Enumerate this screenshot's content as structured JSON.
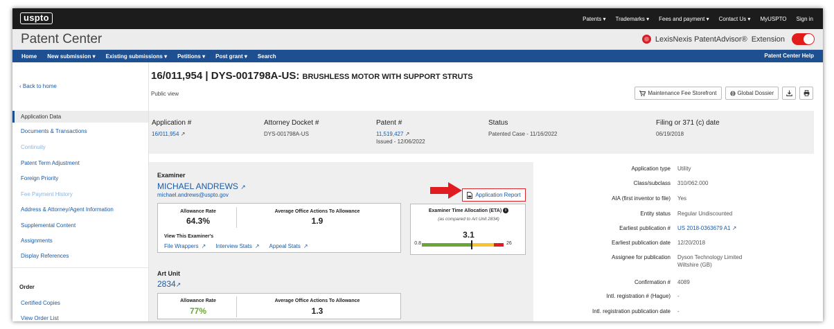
{
  "header": {
    "logo": "uspto",
    "nav": [
      "Patents ▾",
      "Trademarks ▾",
      "Fees and payment ▾",
      "Contact Us ▾",
      "MyUSPTO",
      "Sign in"
    ]
  },
  "titlebar": {
    "app_title": "Patent Center",
    "extension_brand": "LexisNexis PatentAdvisor®",
    "extension_label": "Extension"
  },
  "main_nav": {
    "items": [
      "Home",
      "New submission ▾",
      "Existing submissions ▾",
      "Petitions ▾",
      "Post grant ▾",
      "Search"
    ],
    "help": "Patent Center Help"
  },
  "sidebar": {
    "back": "Back to home",
    "items": [
      {
        "label": "Application Data",
        "state": "active"
      },
      {
        "label": "Documents & Transactions",
        "state": "link"
      },
      {
        "label": "Continuity",
        "state": "disabled"
      },
      {
        "label": "Patent Term Adjustment",
        "state": "link"
      },
      {
        "label": "Foreign Priority",
        "state": "link"
      },
      {
        "label": "Fee Payment History",
        "state": "disabled"
      },
      {
        "label": "Address & Attorney/Agent Information",
        "state": "link"
      },
      {
        "label": "Supplemental Content",
        "state": "link"
      },
      {
        "label": "Assignments",
        "state": "link"
      },
      {
        "label": "Display References",
        "state": "link"
      }
    ],
    "order_heading": "Order",
    "order_items": [
      "Certified Copies",
      "View Order List"
    ]
  },
  "page": {
    "title_main": "16/011,954 | DYS-001798A-US:",
    "title_sub": "BRUSHLESS MOTOR WITH SUPPORT STRUTS",
    "view_mode": "Public view",
    "buttons": {
      "maintenance": "Maintenance Fee Storefront",
      "dossier": "Global Dossier"
    }
  },
  "summary": {
    "application_label": "Application #",
    "application_value": "16/011,954",
    "docket_label": "Attorney Docket #",
    "docket_value": "DYS-001798A-US",
    "patent_label": "Patent #",
    "patent_value": "11,519,427",
    "patent_issued": "Issued - 12/06/2022",
    "status_label": "Status",
    "status_value": "Patented Case - 11/16/2022",
    "filing_label": "Filing or 371 (c) date",
    "filing_value": "06/19/2018"
  },
  "examiner": {
    "heading": "Examiner",
    "name": "MICHAEL ANDREWS",
    "email": "michael.andrews@uspto.gov",
    "allowance_rate_label": "Allowance Rate",
    "allowance_rate": "64.3%",
    "avg_oa_label": "Average Office Actions To Allowance",
    "avg_oa": "1.9",
    "view_label": "View This Examiner's",
    "links": [
      "File Wrappers",
      "Interview Stats",
      "Appeal Stats"
    ],
    "app_report": "Application Report",
    "eta_title": "Examiner Time Allocation (ETA)",
    "eta_subtitle": "(as compared to Art Unit 2834)",
    "eta_value": "3.1",
    "eta_min": "0.8",
    "eta_max": "26",
    "eta_colors": {
      "green": "#6aa53a",
      "yellow": "#f4c431",
      "red": "#e11b22",
      "marker": "#1c1c1c"
    }
  },
  "art_unit": {
    "heading": "Art Unit",
    "number": "2834",
    "allowance_rate_label": "Allowance Rate",
    "allowance_rate": "77%",
    "avg_oa_label": "Average Office Actions To Allowance",
    "avg_oa": "1.3"
  },
  "details": [
    {
      "key": "Application type",
      "value": "Utility",
      "link": false
    },
    {
      "key": "Class/subclass",
      "value": "310/062.000",
      "link": false
    },
    {
      "key": "AIA (first inventor to file)",
      "value": "Yes",
      "link": false
    },
    {
      "key": "Entity status",
      "value": "Regular Undiscounted",
      "link": false
    },
    {
      "key": "Earliest publication #",
      "value": "US 2018-0363679 A1",
      "link": true
    },
    {
      "key": "Earliest publication date",
      "value": "12/20/2018",
      "link": false
    },
    {
      "key": "Assignee for publication",
      "value": "Dyson Technology Limited",
      "value2": "Wiltshire (GB)",
      "link": false
    },
    {
      "key": "Confirmation #",
      "value": "4089",
      "link": false
    },
    {
      "key": "Intl. registration # (Hague)",
      "value": "-",
      "link": false
    },
    {
      "key": "Intl. registration publication date",
      "value": "-",
      "link": false
    }
  ]
}
